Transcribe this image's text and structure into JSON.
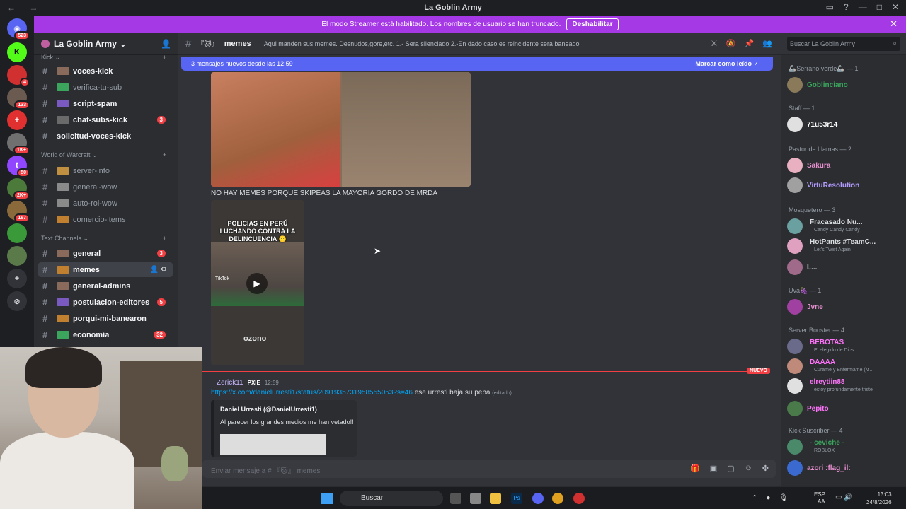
{
  "window": {
    "title": "La Goblin Army"
  },
  "banner": {
    "text": "El modo Streamer está habilitado. Los nombres de usuario se han truncado.",
    "button": "Deshabilitar"
  },
  "server": {
    "name": "La Goblin Army"
  },
  "guild_badges": [
    "523",
    "4",
    "133",
    "1K+",
    "50",
    "2K+",
    "167"
  ],
  "categories": {
    "kick": "Kick",
    "wow": "World of Warcraft",
    "text": "Text Channels"
  },
  "channels": [
    {
      "label": "voces-kick",
      "state": "bright",
      "count": ""
    },
    {
      "label": "verifica-tu-sub",
      "state": "muted",
      "count": ""
    },
    {
      "label": "script-spam",
      "state": "bright",
      "count": ""
    },
    {
      "label": "chat-subs-kick",
      "state": "bright",
      "count": "3"
    },
    {
      "label": "solicitud-voces-kick",
      "state": "bright",
      "count": ""
    },
    {
      "label": "server-info",
      "state": "muted",
      "count": ""
    },
    {
      "label": "general-wow",
      "state": "muted",
      "count": ""
    },
    {
      "label": "auto-rol-wow",
      "state": "muted",
      "count": ""
    },
    {
      "label": "comercio-items",
      "state": "muted",
      "count": ""
    },
    {
      "label": "general",
      "state": "bright",
      "count": "3"
    },
    {
      "label": "memes",
      "state": "active",
      "count": ""
    },
    {
      "label": "general-admins",
      "state": "bright",
      "count": ""
    },
    {
      "label": "postulacion-editores",
      "state": "bright",
      "count": "5"
    },
    {
      "label": "porqui-mi-banearon",
      "state": "bright",
      "count": ""
    },
    {
      "label": "economía",
      "state": "bright",
      "count": "32"
    }
  ],
  "header": {
    "channel": "memes",
    "topic": "Aqui manden sus memes. Desnudos,gore,etc. 1.- Sera silenciado 2.-En dado caso es reincidente sera baneado",
    "search_placeholder": "Buscar La Goblin Army"
  },
  "chat": {
    "new_messages": "3 mensajes nuevos desde las 12:59",
    "mark_read": "Marcar como leído",
    "message1": "NO HAY MEMES PORQUE SKIPEAS LA MAYORIA GORDO DE MRDA",
    "video_caption": "POLICIAS EN PERÚ LUCHANDO CONTRA LA DELINCUENCIA 🙁",
    "video_tiktok": "TikTok",
    "video_brand": "ozono",
    "new_label": "NUEVO",
    "author": "Zerick11",
    "author_tag": "PXIE",
    "time": "12:59",
    "link": "https://x.com/danielurresti1/status/2091935731958555053?s=46",
    "link_rest": "ese urresti baja su pepa",
    "edited": "(editado)",
    "embed_author": "Daniel Urresti (@DanielUrresti1)",
    "embed_text": "Al parecer los grandes medios me han vetado!!",
    "composer_placeholder": "Enviar mensaje a # 『🐱』 memes"
  },
  "members": {
    "groups": [
      {
        "title": "🦾Serrano verde🦾 — 1"
      },
      {
        "title": "Staff — 1"
      },
      {
        "title": "Pastor de Llamas — 2"
      },
      {
        "title": "Mosquetero — 3"
      },
      {
        "title": "Uva🍇 — 1"
      },
      {
        "title": "Server Booster — 4"
      },
      {
        "title": "Kick Suscriber — 4"
      }
    ],
    "list": [
      {
        "name": "Goblinciano",
        "status": "",
        "color": "#3ba55d"
      },
      {
        "name": "71u53r14",
        "status": "",
        "color": "#ffffff"
      },
      {
        "name": "Sakura",
        "status": "",
        "color": "#e890d0"
      },
      {
        "name": "VirtuResolution",
        "status": "",
        "color": "#b49cff"
      },
      {
        "name": "Fracasado Nu...",
        "status": "Candy Candy Candy",
        "color": "#dbdee1"
      },
      {
        "name": "HotPants #TeamC...",
        "status": "Let's Twist Again",
        "color": "#dbdee1"
      },
      {
        "name": "L...",
        "status": "",
        "color": "#dbdee1"
      },
      {
        "name": "Jvne",
        "status": "",
        "color": "#e890d0"
      },
      {
        "name": "BEBOTAS",
        "status": "El elegido de Dios",
        "color": "#ff73fa"
      },
      {
        "name": "DAAAA",
        "status": "Curame y Enfermame (M...",
        "color": "#ff73fa"
      },
      {
        "name": "elreytiin88",
        "status": "estoy profundamente triste",
        "color": "#ff73fa"
      },
      {
        "name": "Pepito",
        "status": "",
        "color": "#ff73fa"
      },
      {
        "name": "- ceviche -",
        "status": "ROBLOX",
        "color": "#3ba55d"
      },
      {
        "name": "azori :flag_il:",
        "status": "",
        "color": "#e890d0"
      }
    ]
  },
  "taskbar": {
    "search": "Buscar",
    "lang1": "ESP",
    "lang2": "LAA",
    "time": "13:03",
    "date": "24/8/2026"
  }
}
